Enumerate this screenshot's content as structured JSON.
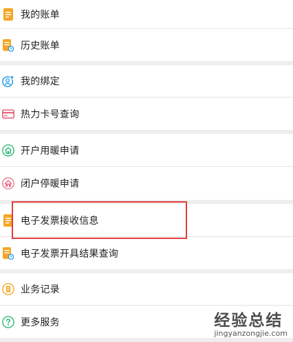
{
  "menu": {
    "items": [
      {
        "label": "我的账单",
        "icon": "bill-icon"
      },
      {
        "label": "历史账单",
        "icon": "history-bill-icon"
      },
      {
        "label": "我的绑定",
        "icon": "bind-user-icon"
      },
      {
        "label": "热力卡号查询",
        "icon": "card-icon"
      },
      {
        "label": "开户用暖申请",
        "icon": "house-icon"
      },
      {
        "label": "闭户停暖申请",
        "icon": "stop-house-icon"
      },
      {
        "label": "电子发票接收信息",
        "icon": "invoice-icon"
      },
      {
        "label": "电子发票开具结果查询",
        "icon": "invoice-query-icon"
      },
      {
        "label": "业务记录",
        "icon": "record-icon"
      },
      {
        "label": "更多服务",
        "icon": "more-services-icon"
      }
    ]
  },
  "colors": {
    "orange": "#f5a623",
    "blue": "#1e9be8",
    "pink": "#e65c78",
    "green": "#2bb673",
    "highlight": "#e23b3b",
    "separator": "#eeeeee"
  },
  "watermark": {
    "main": "经验总结",
    "url": "jingyanzongjie.com"
  }
}
